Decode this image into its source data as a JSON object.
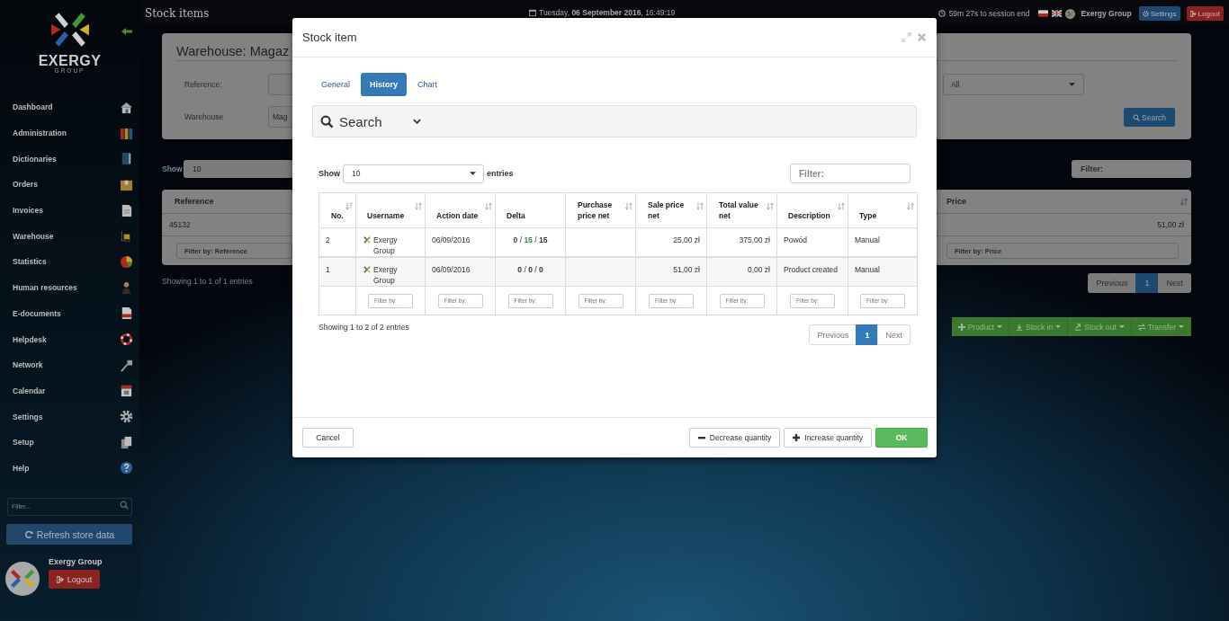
{
  "topbar": {
    "title": "Stock items",
    "datetime": "Tuesday, **06 September 2016**, 16:49:19",
    "session": "59m 27s to session end",
    "user": "Exergy Group",
    "settings": "Settings",
    "logout": "Logout"
  },
  "sidebar": {
    "logo_text": "EXERGY",
    "logo_subtext": "GROUP",
    "items": [
      {
        "label": "Dashboard"
      },
      {
        "label": "Administration"
      },
      {
        "label": "Dictionaries"
      },
      {
        "label": "Orders"
      },
      {
        "label": "Invoices"
      },
      {
        "label": "Warehouse"
      },
      {
        "label": "Statistics"
      },
      {
        "label": "Human resources"
      },
      {
        "label": "E-documents"
      },
      {
        "label": "Helpdesk"
      },
      {
        "label": "Network"
      },
      {
        "label": "Calendar"
      },
      {
        "label": "Settings"
      },
      {
        "label": "Setup"
      },
      {
        "label": "Help"
      }
    ],
    "filter": {
      "placeholder": "Filter..."
    },
    "refresh_button": "Refresh store data",
    "user": {
      "name": "Exergy Group",
      "logout": "Logout"
    }
  },
  "page": {
    "panel_title": "Warehouse: Magaz",
    "fields": [
      {
        "label": "Reference:"
      },
      {
        "label": "Warehouse",
        "value": "Mag"
      }
    ],
    "select_value": "All",
    "search_button": "Search",
    "show_label": "Show",
    "show_value": "10",
    "filter_placeholder": "Filter:",
    "columns": [
      "Reference",
      "Price"
    ],
    "row": [
      "45132",
      "51,00 zł"
    ],
    "column_filters": [
      {
        "placeholder": "Filter by: Reference"
      },
      {
        "placeholder": "Filter by: Price"
      }
    ],
    "info": "Showing 1 to 1 of 1 entries",
    "pagination": [
      {
        "label": "Previous",
        "selected": false
      },
      {
        "label": "1",
        "selected": true
      },
      {
        "label": "Next",
        "selected": false
      }
    ],
    "actions": [
      "Product",
      "Stock in",
      "Stock out",
      "Transfer"
    ]
  },
  "modal": {
    "title": "Stock item",
    "tabs": [
      {
        "label": "General",
        "selected": false
      },
      {
        "label": "History",
        "selected": true
      },
      {
        "label": "Chart",
        "selected": false
      }
    ],
    "search_panel": "Search",
    "show_label": "Show",
    "page_length": "10",
    "entries_label": "entries",
    "filter_placeholder": "Filter:",
    "columns": [
      {
        "label": "No.",
        "sortable": true,
        "sorted": true
      },
      {
        "label": "Username",
        "sortable": true,
        "sorted": false
      },
      {
        "label": "Action date",
        "sortable": true,
        "sorted": false
      },
      {
        "label": "Delta",
        "sortable": false
      },
      {
        "label": "Purchase price net",
        "sortable": true,
        "sorted": false
      },
      {
        "label": "Sale price net",
        "sortable": true,
        "sorted": false
      },
      {
        "label": "Total value net",
        "sortable": true,
        "sorted": false
      },
      {
        "label": "Description",
        "sortable": true,
        "sorted": false
      },
      {
        "label": "Type",
        "sortable": true,
        "sorted": false
      }
    ],
    "rows": [
      {
        "no": "2",
        "username": "Exergy Group",
        "action_date": "06/09/2016",
        "delta": [
          {
            "text": "0",
            "kind": "plain"
          },
          {
            "text": "/",
            "kind": "separator"
          },
          {
            "text": "15",
            "kind": "change"
          },
          {
            "text": "/",
            "kind": "separator"
          },
          {
            "text": "15",
            "kind": "plain"
          }
        ],
        "sale_price_net": "25,00 zł",
        "total_value_net": "375,00 zł",
        "description": "Powód",
        "type": "Manual"
      },
      {
        "no": "1",
        "username": "Exergy Group",
        "action_date": "06/09/2016",
        "delta": [
          {
            "text": "0",
            "kind": "plain"
          },
          {
            "text": "/",
            "kind": "separator"
          },
          {
            "text": "0",
            "kind": "plain"
          },
          {
            "text": "/",
            "kind": "separator"
          },
          {
            "text": "0",
            "kind": "plain"
          }
        ],
        "sale_price_net": "51,00 zł",
        "total_value_net": "0,00 zł",
        "description": "Product created",
        "type": "Manual"
      }
    ],
    "column_filters": [
      {
        "placeholder": "Filter by:"
      },
      {
        "placeholder": "Filter by:"
      },
      {
        "placeholder": "Filter by:"
      },
      {
        "placeholder": "Filter by:"
      },
      {
        "placeholder": "Filter by:"
      },
      {
        "placeholder": "Filter by:"
      },
      {
        "placeholder": "Filter by:"
      },
      {
        "placeholder": "Filter by:"
      }
    ],
    "info": "Showing 1 to 2 of 2 entries",
    "pagination": [
      {
        "label": "Previous",
        "selected": false
      },
      {
        "label": "1",
        "selected": true
      },
      {
        "label": "Next",
        "selected": false
      }
    ],
    "buttons": {
      "cancel": "Cancel",
      "decrease": "Decrease quantity",
      "increase": "Increase quantity",
      "ok": "OK"
    }
  }
}
